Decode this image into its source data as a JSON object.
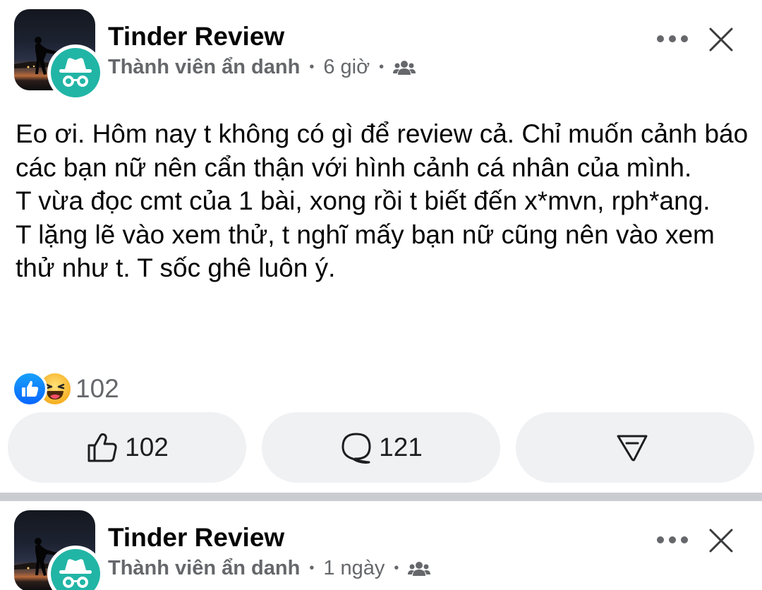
{
  "posts": [
    {
      "group_name": "Tinder Review",
      "author": "Thành viên ẩn danh",
      "time": "6 giờ",
      "audience_icon": "group-members-icon",
      "body": [
        "Eo ơi. Hôm nay t không có gì để review cả. Chỉ muốn cảnh báo các bạn nữ nên cẩn thận với hình cảnh cá nhân của mình.",
        "T vừa đọc cmt của 1 bài, xong rồi t biết đến x*mvn, rph*ang.",
        "T lặng lẽ vào xem thử, t nghĩ mấy bạn nữ cũng nên vào xem thử như t. T sốc ghê luôn ý."
      ],
      "reactions": {
        "icons": [
          "like-reaction-icon",
          "haha-reaction-icon"
        ],
        "count": "102"
      },
      "actions": {
        "like_count": "102",
        "comment_count": "121",
        "share_icon": "share-icon"
      }
    },
    {
      "group_name": "Tinder Review",
      "author": "Thành viên ẩn danh",
      "time": "1 ngày",
      "audience_icon": "group-members-icon"
    }
  ],
  "colors": {
    "text_primary": "#050505",
    "text_secondary": "#65676b",
    "button_bg": "#eff1f3",
    "separator": "#c9ccd1",
    "anon_avatar": "#21b5a6",
    "like_blue": "#0866ff",
    "haha_yellow": "#f7b125"
  }
}
